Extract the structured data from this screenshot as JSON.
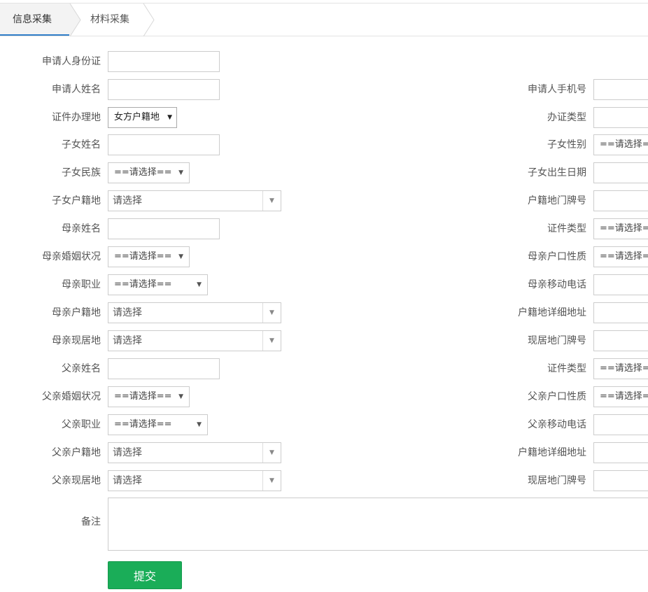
{
  "tabs": [
    {
      "label": "信息采集",
      "active": true
    },
    {
      "label": "材料采集",
      "active": false
    }
  ],
  "form": {
    "applicant_id": {
      "label": "申请人身份证",
      "value": ""
    },
    "applicant_name": {
      "label": "申请人姓名",
      "value": ""
    },
    "applicant_phone": {
      "label": "申请人手机号",
      "value": ""
    },
    "cert_location": {
      "label": "证件办理地",
      "value": "女方户籍地"
    },
    "cert_type": {
      "label": "办证类型",
      "value": ""
    },
    "child_name": {
      "label": "子女姓名",
      "value": ""
    },
    "child_gender": {
      "label": "子女性别",
      "value": "==请选择=="
    },
    "child_ethnicity": {
      "label": "子女民族",
      "value": "==请选择=="
    },
    "child_birthdate": {
      "label": "子女出生日期",
      "value": ""
    },
    "child_household": {
      "label": "子女户籍地",
      "value": "请选择"
    },
    "household_door_no": {
      "label": "户籍地门牌号",
      "value": ""
    },
    "mother_name": {
      "label": "母亲姓名",
      "value": ""
    },
    "mother_id_type": {
      "label": "证件类型",
      "value": "==请选择=="
    },
    "mother_marital": {
      "label": "母亲婚姻状况",
      "value": "==请选择=="
    },
    "mother_hukou_type": {
      "label": "母亲户口性质",
      "value": "==请选择=="
    },
    "mother_job": {
      "label": "母亲职业",
      "value": "==请选择=="
    },
    "mother_mobile": {
      "label": "母亲移动电话",
      "value": ""
    },
    "mother_household": {
      "label": "母亲户籍地",
      "value": "请选择"
    },
    "mother_household_addr": {
      "label": "户籍地详细地址",
      "value": ""
    },
    "mother_residence": {
      "label": "母亲现居地",
      "value": "请选择"
    },
    "mother_residence_door": {
      "label": "现居地门牌号",
      "value": ""
    },
    "father_name": {
      "label": "父亲姓名",
      "value": ""
    },
    "father_id_type": {
      "label": "证件类型",
      "value": "==请选择=="
    },
    "father_marital": {
      "label": "父亲婚姻状况",
      "value": "==请选择=="
    },
    "father_hukou_type": {
      "label": "父亲户口性质",
      "value": "==请选择=="
    },
    "father_job": {
      "label": "父亲职业",
      "value": "==请选择=="
    },
    "father_mobile": {
      "label": "父亲移动电话",
      "value": ""
    },
    "father_household": {
      "label": "父亲户籍地",
      "value": "请选择"
    },
    "father_household_addr": {
      "label": "户籍地详细地址",
      "value": ""
    },
    "father_residence": {
      "label": "父亲现居地",
      "value": "请选择"
    },
    "father_residence_door": {
      "label": "现居地门牌号",
      "value": ""
    },
    "remark": {
      "label": "备注",
      "value": ""
    }
  },
  "submit_label": "提交",
  "colors": {
    "submit": "#1aad58",
    "tab_active_underline": "#2f7dc8"
  }
}
